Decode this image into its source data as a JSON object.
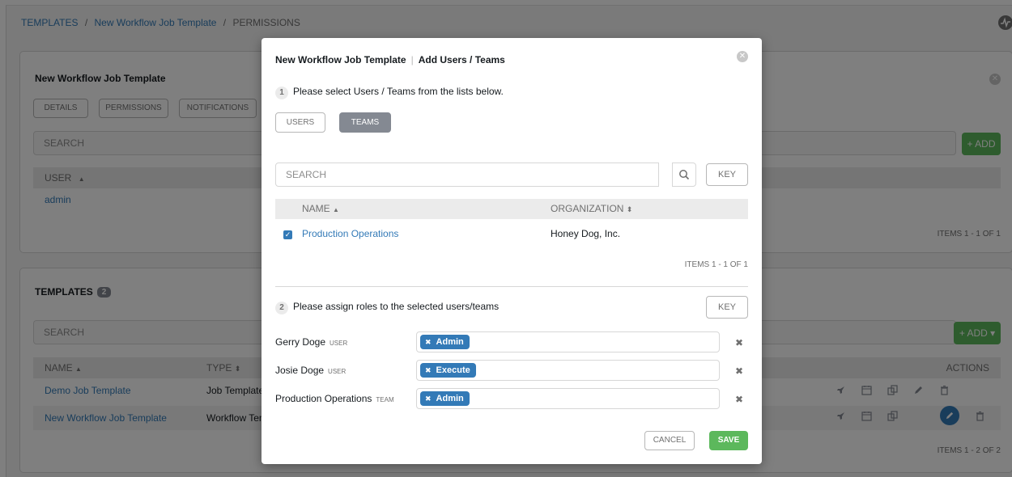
{
  "breadcrumb": {
    "items": [
      "TEMPLATES",
      "New Workflow Job Template"
    ],
    "current": "PERMISSIONS",
    "separator": "/"
  },
  "panel1": {
    "title": "New Workflow Job Template",
    "tabs": [
      "DETAILS",
      "PERMISSIONS",
      "NOTIFICATIONS"
    ],
    "search_placeholder": "SEARCH",
    "add_label": "+ ADD",
    "column_user": "USER",
    "sort_indicator": "▲",
    "rows": [
      "admin"
    ],
    "items_count": "ITEMS  1 - 1 OF 1"
  },
  "panel2": {
    "title": "TEMPLATES",
    "badge": "2",
    "search_placeholder": "SEARCH",
    "add_label": "+ ADD ▾",
    "columns": {
      "name": "NAME",
      "type": "TYPE",
      "actions": "ACTIONS"
    },
    "sort_name": "▲",
    "sort_type": "⬍",
    "rows": [
      {
        "name": "Demo Job Template",
        "type": "Job Template"
      },
      {
        "name": "New Workflow Job Template",
        "type": "Workflow Tem"
      }
    ],
    "items_count": "ITEMS  1 - 2 OF 2"
  },
  "modal": {
    "title_main": "New Workflow Job Template",
    "title_sub": "Add Users / Teams",
    "step1_num": "1",
    "step1_text": "Please select Users / Teams from the lists below.",
    "toggle_users": "USERS",
    "toggle_teams": "TEAMS",
    "search_placeholder": "SEARCH",
    "key_label": "KEY",
    "col_name": "NAME",
    "col_name_sort": "▲",
    "col_org": "ORGANIZATION",
    "col_org_sort": "⬍",
    "rows": [
      {
        "name": "Production Operations",
        "organization": "Honey Dog, Inc.",
        "checked": true
      }
    ],
    "items_count": "ITEMS  1 - 1 OF 1",
    "step2_num": "2",
    "step2_text": "Please assign roles to the selected users/teams",
    "key2_label": "KEY",
    "assignments": [
      {
        "name": "Gerry Doge",
        "type": "USER",
        "role": "Admin"
      },
      {
        "name": "Josie Doge",
        "type": "USER",
        "role": "Execute"
      },
      {
        "name": "Production Operations",
        "type": "TEAM",
        "role": "Admin"
      }
    ],
    "cancel_label": "CANCEL",
    "save_label": "SAVE"
  },
  "icons": {
    "close": "✕",
    "search": "⚲",
    "remove": "✖",
    "tag_remove": "✖",
    "check": "✓",
    "launch": "rocket-icon",
    "schedule": "calendar-icon",
    "copy": "copy-icon",
    "edit": "pencil-icon",
    "delete": "trash-icon",
    "activity": "activity-stream-icon"
  },
  "colors": {
    "link": "#337ab7",
    "success": "#5cb85c",
    "toggle_active": "#848992",
    "overlay": "rgba(0,0,0,0.5)"
  }
}
